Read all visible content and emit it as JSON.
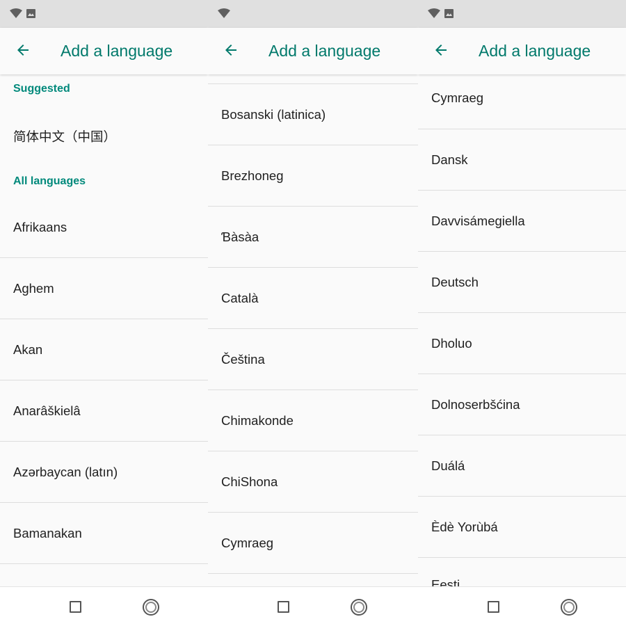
{
  "appbar": {
    "title": "Add a language"
  },
  "sections": {
    "suggested": "Suggested",
    "all": "All languages"
  },
  "panel0": {
    "suggested": [
      "简体中文（中国）"
    ],
    "items": [
      "Afrikaans",
      "Aghem",
      "Akan",
      "Anarâškielâ",
      "Azərbaycan (latın)",
      "Bamanakan"
    ]
  },
  "panel1": {
    "items": [
      "Bosanski (latinica)",
      "Brezhoneg",
      "Ɓàsàa",
      "Català",
      "Čeština",
      "Chimakonde",
      "ChiShona",
      "Cymraeg"
    ]
  },
  "panel2": {
    "items": [
      "Cymraeg",
      "Dansk",
      "Davvisámegiella",
      "Deutsch",
      "Dholuo",
      "Dolnoserbšćina",
      "Duálá",
      "Èdè Yorùbá",
      "Eesti"
    ]
  },
  "colors": {
    "accent": "#00796b",
    "statusbar": "#e0e0e0",
    "background": "#fafafa"
  },
  "icons": {
    "status": [
      "wifi-icon",
      "image-icon"
    ],
    "back": "arrow-back-icon",
    "nav": [
      "recents-icon",
      "home-icon"
    ]
  }
}
